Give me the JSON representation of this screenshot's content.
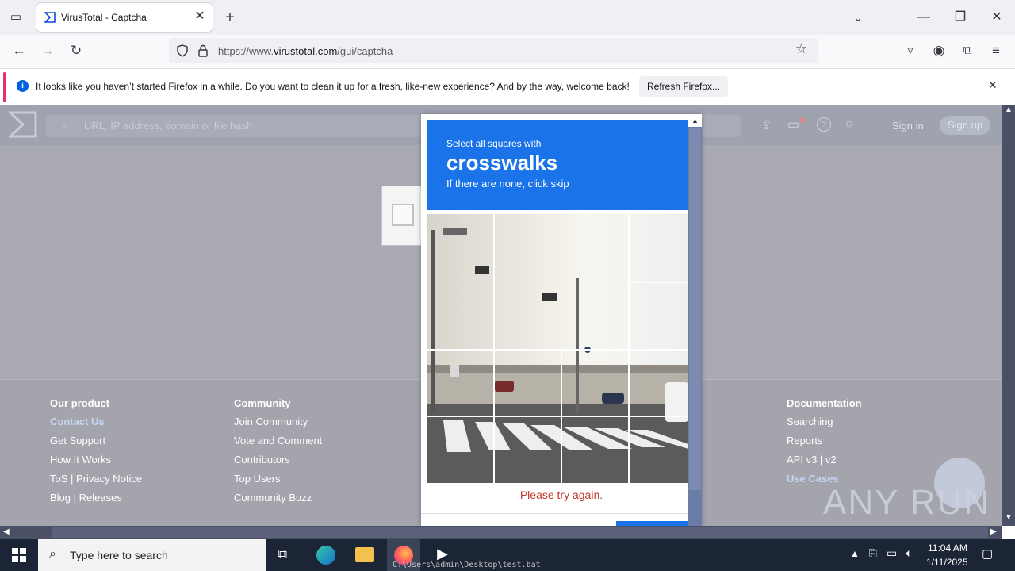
{
  "browser": {
    "tab_title": "VirusTotal - Captcha",
    "url_prefix": "https://www.",
    "url_domain": "virustotal.com",
    "url_path": "/gui/captcha"
  },
  "notification": {
    "message": "It looks like you haven’t started Firefox in a while. Do you want to clean it up for a fresh, like-new experience? And by the way, welcome back!",
    "button": "Refresh Firefox..."
  },
  "vt": {
    "search_placeholder": "URL, IP address, domain or file hash",
    "sign_in": "Sign in",
    "sign_up": "Sign up"
  },
  "footer": {
    "col1": {
      "heading": "Our product",
      "links": [
        "Contact Us",
        "Get Support",
        "How It Works",
        "ToS | Privacy Notice",
        "Blog | Releases"
      ]
    },
    "col2": {
      "heading": "Community",
      "links": [
        "Join Community",
        "Vote and Comment",
        "Contributors",
        "Top Users",
        "Community Buzz"
      ]
    },
    "col3": {
      "heading": "Documentation",
      "links": [
        "Searching",
        "Reports",
        "API v3 | v2",
        "Use Cases"
      ]
    }
  },
  "captcha": {
    "instruction": "Select all squares with",
    "target": "crosswalks",
    "hint": "If there are none, click skip",
    "error": "Please try again."
  },
  "watermark": "ANY RUN",
  "taskbar": {
    "search_placeholder": "Type here to search",
    "time": "11:04 AM",
    "date": "1/11/2025",
    "console_text": "C:\\Users\\admin\\Desktop\\test.bat"
  }
}
